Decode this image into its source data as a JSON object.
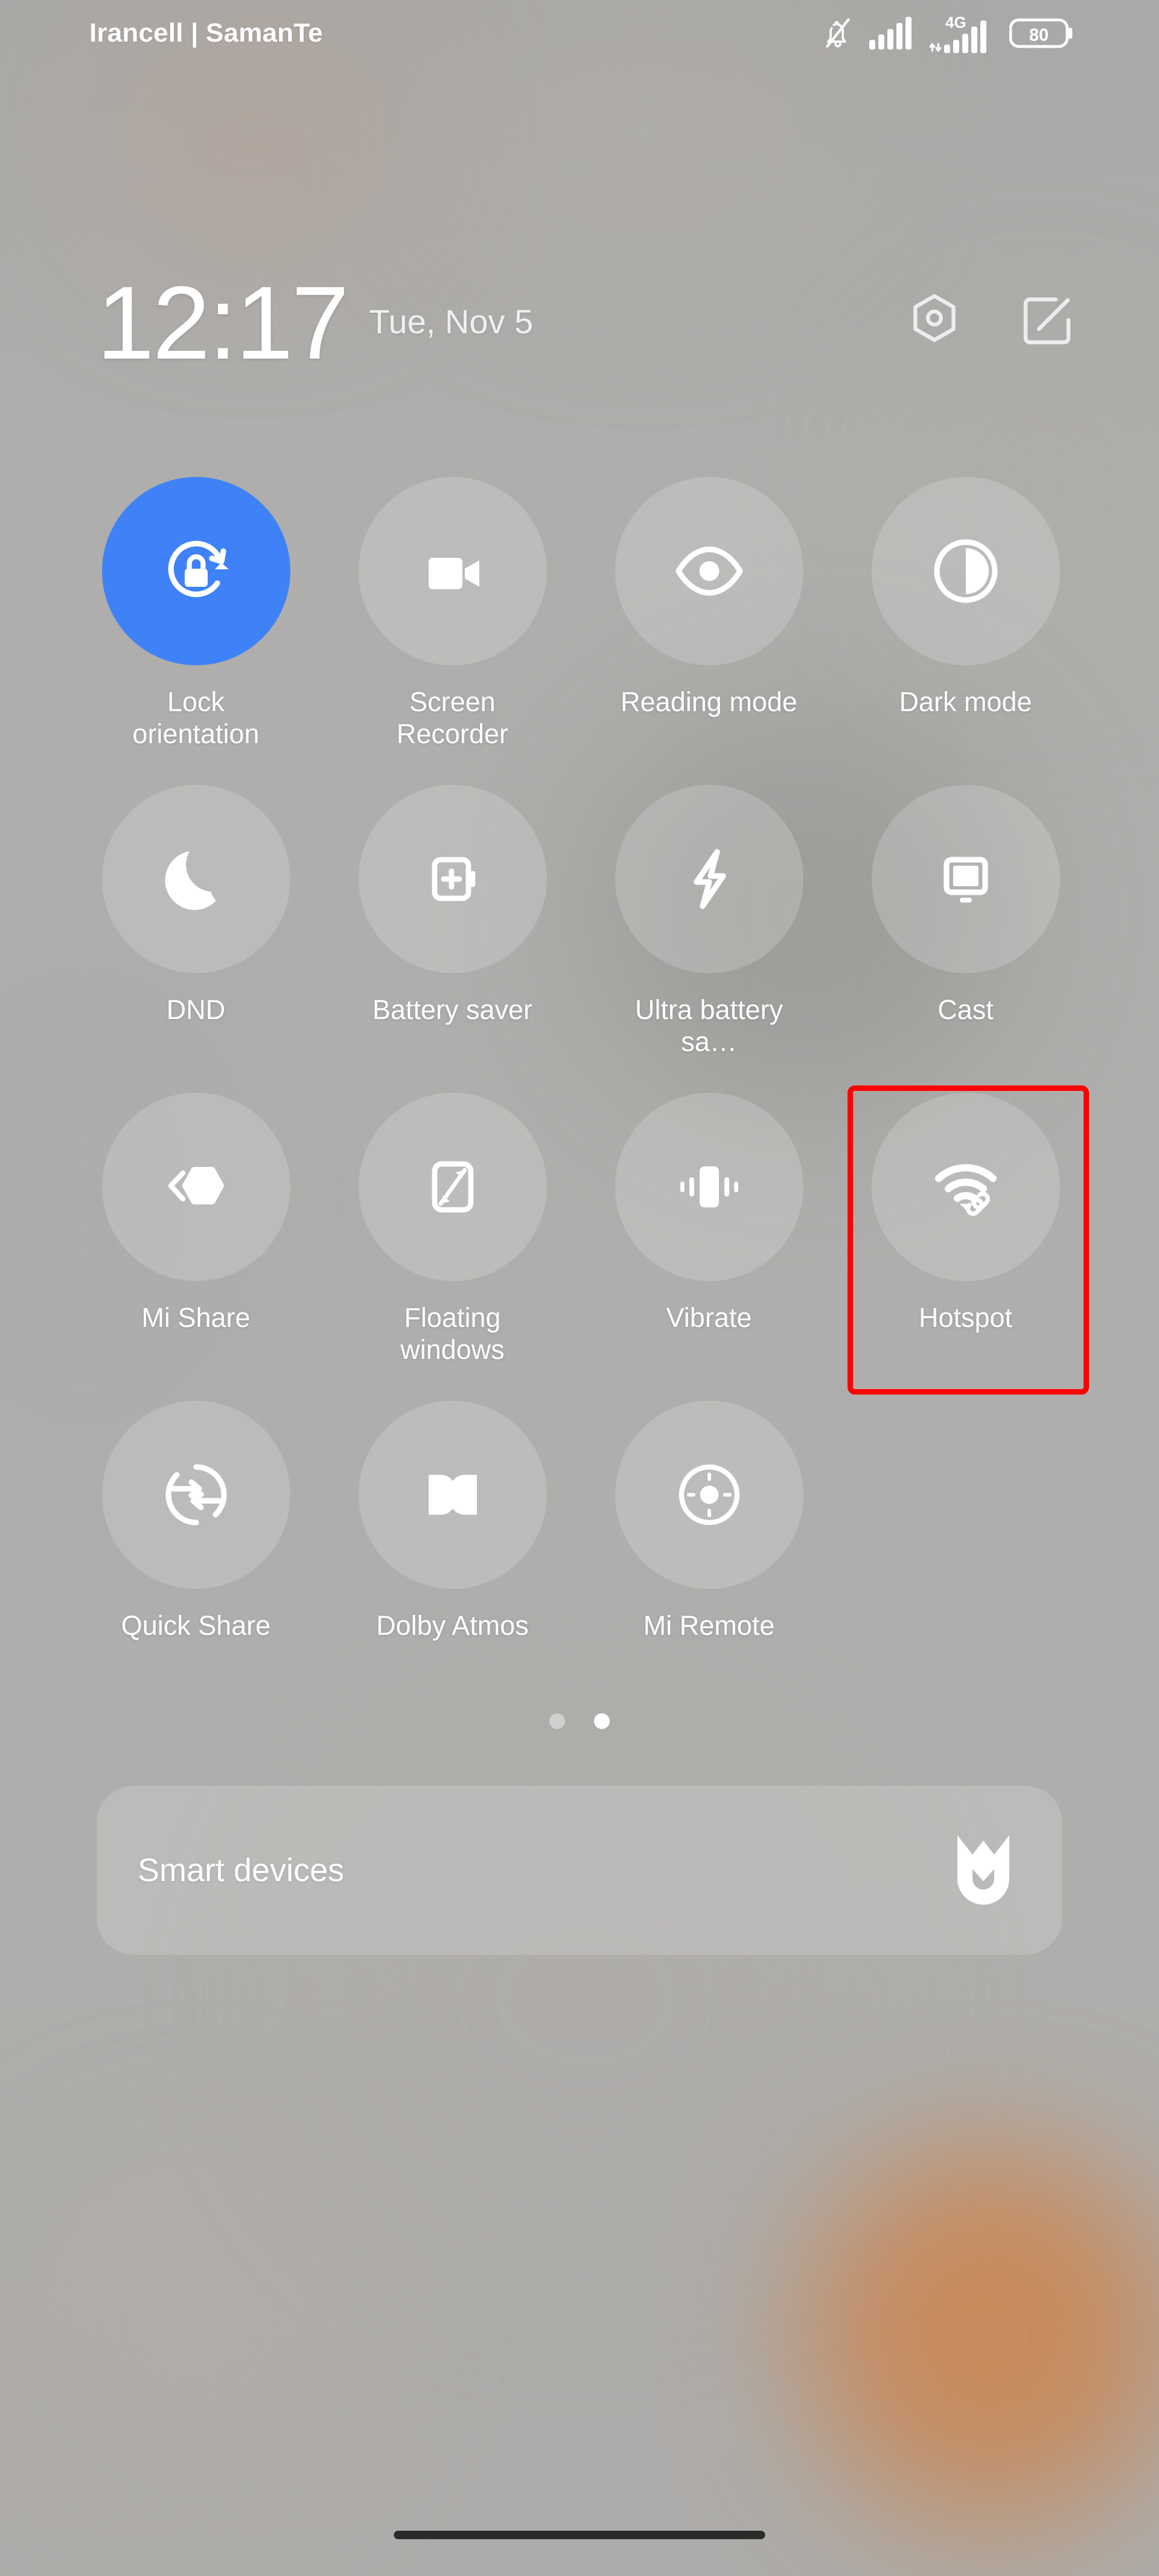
{
  "status_bar": {
    "carrier": "Irancell | SamanTe",
    "icons": [
      "bell-off-icon",
      "signal-bars-icon",
      "signal-4g-icon",
      "battery-icon"
    ],
    "network_type": "4G",
    "battery_percent": "80"
  },
  "header": {
    "time": "12:17",
    "date": "Tue, Nov 5",
    "actions": [
      {
        "name": "settings-button",
        "icon": "hex-gear-icon"
      },
      {
        "name": "edit-tiles-button",
        "icon": "edit-square-icon"
      }
    ]
  },
  "tiles": [
    {
      "label": "Lock orientation",
      "icon": "lock-rotation-icon",
      "active": true,
      "name": "tile-lock-orientation"
    },
    {
      "label": "Screen Recorder",
      "icon": "video-camera-icon",
      "active": false,
      "name": "tile-screen-recorder"
    },
    {
      "label": "Reading mode",
      "icon": "eye-icon",
      "active": false,
      "name": "tile-reading-mode"
    },
    {
      "label": "Dark mode",
      "icon": "contrast-circle-icon",
      "active": false,
      "name": "tile-dark-mode"
    },
    {
      "label": "DND",
      "icon": "moon-icon",
      "active": false,
      "name": "tile-dnd"
    },
    {
      "label": "Battery saver",
      "icon": "battery-plus-icon",
      "active": false,
      "name": "tile-battery-saver"
    },
    {
      "label": "Ultra battery sa…",
      "icon": "lightning-bolt-icon",
      "active": false,
      "name": "tile-ultra-battery-saver"
    },
    {
      "label": "Cast",
      "icon": "cast-monitor-icon",
      "active": false,
      "name": "tile-cast"
    },
    {
      "label": "Mi Share",
      "icon": "mi-share-icon",
      "active": false,
      "name": "tile-mi-share"
    },
    {
      "label": "Floating windows",
      "icon": "floating-window-icon",
      "active": false,
      "name": "tile-floating-windows"
    },
    {
      "label": "Vibrate",
      "icon": "vibrate-icon",
      "active": false,
      "name": "tile-vibrate"
    },
    {
      "label": "Hotspot",
      "icon": "hotspot-wifi-link-icon",
      "active": false,
      "name": "tile-hotspot",
      "highlighted": true
    },
    {
      "label": "Quick Share",
      "icon": "quick-share-icon",
      "active": false,
      "name": "tile-quick-share"
    },
    {
      "label": "Dolby Atmos",
      "icon": "dolby-atmos-icon",
      "active": false,
      "name": "tile-dolby-atmos"
    },
    {
      "label": "Mi Remote",
      "icon": "mi-remote-icon",
      "active": false,
      "name": "tile-mi-remote"
    }
  ],
  "pager": {
    "count": 2,
    "active_index": 1
  },
  "smart_devices": {
    "label": "Smart devices",
    "icon": "mi-home-logo-icon"
  },
  "colors": {
    "accent_active": "#3F82F7",
    "highlight_box": "#FF0000",
    "background": "#AFAEAC",
    "tile_bg": "rgba(255,255,255,0.175)",
    "text": "#FFFFFF"
  }
}
